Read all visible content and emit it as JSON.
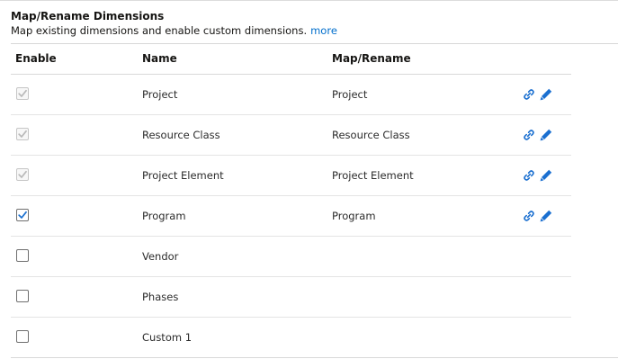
{
  "section": {
    "title": "Map/Rename Dimensions",
    "description": "Map existing dimensions and enable custom dimensions.",
    "more_link": "more"
  },
  "columns": {
    "enable": "Enable",
    "name": "Name",
    "map_rename": "Map/Rename"
  },
  "rows": [
    {
      "name": "Project",
      "map": "Project",
      "checked": true,
      "disabled": true,
      "has_actions": true
    },
    {
      "name": "Resource Class",
      "map": "Resource Class",
      "checked": true,
      "disabled": true,
      "has_actions": true
    },
    {
      "name": "Project Element",
      "map": "Project Element",
      "checked": true,
      "disabled": true,
      "has_actions": true
    },
    {
      "name": "Program",
      "map": "Program",
      "checked": true,
      "disabled": false,
      "has_actions": true
    },
    {
      "name": "Vendor",
      "map": "",
      "checked": false,
      "disabled": false,
      "has_actions": false
    },
    {
      "name": "Phases",
      "map": "",
      "checked": false,
      "disabled": false,
      "has_actions": false
    },
    {
      "name": "Custom 1",
      "map": "",
      "checked": false,
      "disabled": false,
      "has_actions": false
    }
  ],
  "icons": {
    "map": "link-icon",
    "rename": "pencil-icon"
  },
  "colors": {
    "link": "#006ecc",
    "icon": "#1a6fd0",
    "check_enabled": "#1a6fd0",
    "check_disabled": "#b9b9b9",
    "text": "#161513"
  }
}
